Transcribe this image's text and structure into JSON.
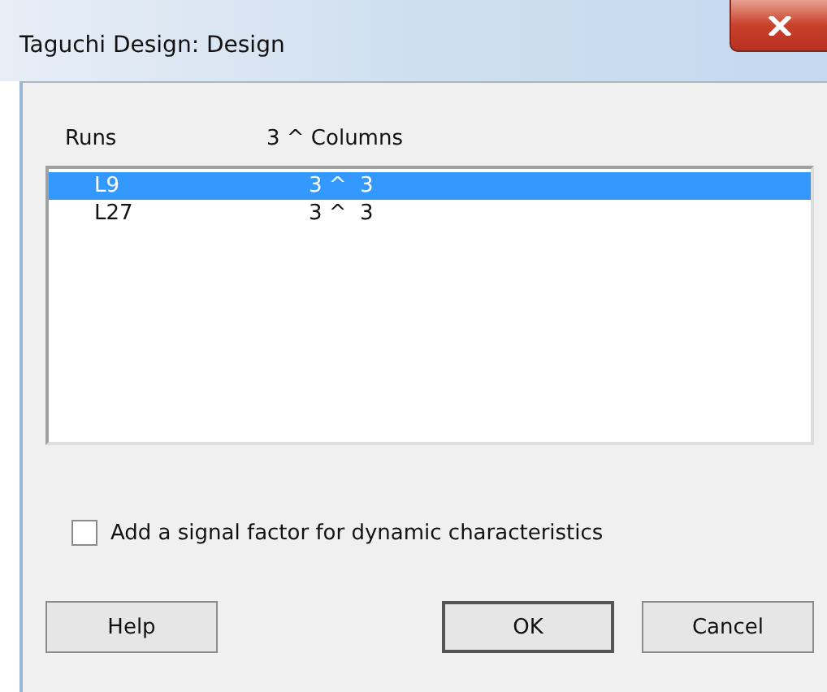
{
  "window": {
    "title": "Taguchi Design: Design"
  },
  "table": {
    "columns": [
      "Runs",
      "3 ^ Columns"
    ],
    "rows": [
      {
        "cells": [
          "L9",
          "3 ^  3"
        ],
        "selected": true
      },
      {
        "cells": [
          "L27",
          "3 ^  3"
        ],
        "selected": false
      }
    ]
  },
  "signal_factor": {
    "label": "Add a signal factor for dynamic characteristics",
    "checked": false
  },
  "buttons": [
    {
      "label": "Help",
      "kind": "help"
    },
    {
      "label": "OK",
      "kind": "ok"
    },
    {
      "label": "Cancel",
      "kind": "cancel"
    }
  ]
}
